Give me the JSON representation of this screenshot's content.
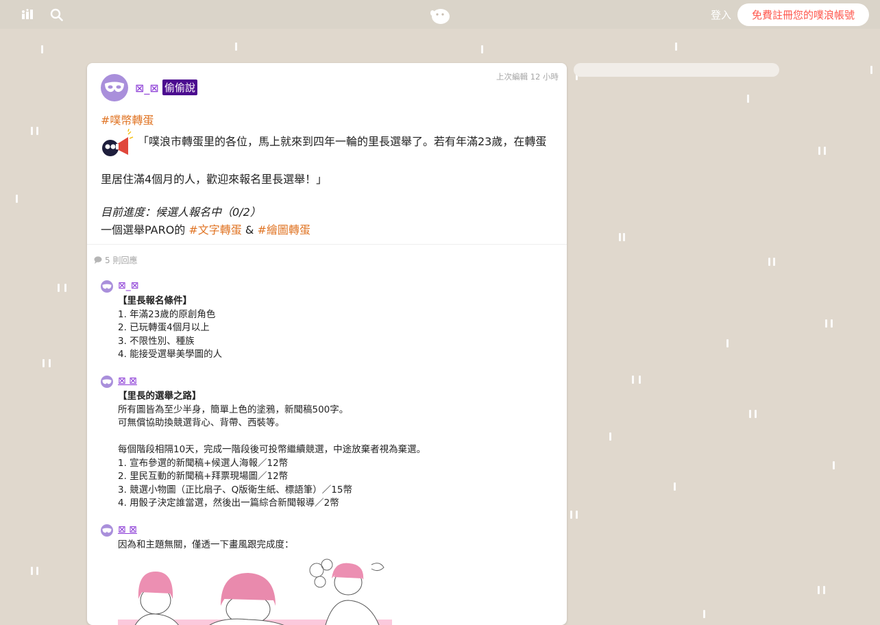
{
  "topbar": {
    "login_label": "登入",
    "signup_label": "免費註冊您的噗浪帳號",
    "icons": [
      "community-icon",
      "search-icon",
      "plurk-logo-icon"
    ]
  },
  "post": {
    "poster_name": "⊠_⊠",
    "badge": "偷偷說",
    "edited": "上次編輯 12 小時",
    "hashtag_main": "#噗幣轉蛋",
    "text_1": "「噗浪市轉蛋里的各位，馬上就來到四年一輪的里長選舉了。若有年滿23歲，在轉蛋",
    "text_2": "里居住滿4個月的人，歡迎來報名里長選舉！」",
    "progress": "目前進度：候選人報名中（0/2）",
    "line_prefix": "一個選舉PARO的 ",
    "tag_text": "#文字轉蛋",
    "amp": " & ",
    "tag_draw": "#繪圖轉蛋"
  },
  "responses": {
    "count_label": "5 則回應",
    "r1": {
      "name": "⊠_⊠",
      "title": "【里長報名條件】",
      "items": [
        "1. 年滿23歲的原創角色",
        "2. 已玩轉蛋4個月以上",
        "3. 不限性別、種族",
        "4. 能接受選舉美學圖的人"
      ]
    },
    "r2": {
      "name": "⊠ ⊠",
      "title": "【里長的選舉之路】",
      "p1": "所有圖皆為至少半身，簡單上色的塗鴉，新聞稿500字。",
      "p2": "可無償協助換競選背心、背帶、西裝等。",
      "p3": "每個階段相隔10天，完成一階段後可投幣繼續競選，中途放棄者視為棄選。",
      "items": [
        "1. 宣布參選的新聞稿+候選人海報／12幣",
        "2. 里民互動的新聞稿+拜票現場圖／12幣",
        "3. 競選小物圖（正比扇子、Q版衛生紙、標語筆）／15幣",
        "4. 用骰子決定誰當選，然後出一篇綜合新聞報導／2幣"
      ]
    },
    "r3": {
      "name": "⊠ ⊠",
      "text": "因為和主題無關，僅透一下畫風跟完成度："
    }
  },
  "colors": {
    "background": "#e0d8cd",
    "accent_orange": "#e07424",
    "name_purple": "#8b3bd6",
    "badge_purple": "#4b0a8f",
    "signup_red": "#ff574d"
  }
}
